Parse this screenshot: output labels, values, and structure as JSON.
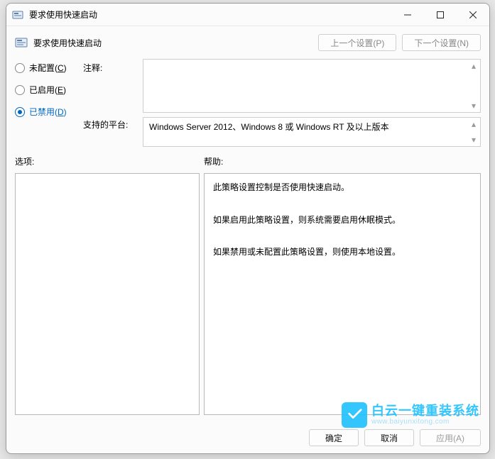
{
  "window": {
    "title": "要求使用快速启动"
  },
  "header": {
    "title": "要求使用快速启动",
    "prev_btn": "上一个设置(P)",
    "next_btn": "下一个设置(N)"
  },
  "radios": {
    "not_configured": {
      "label_pre": "未配置(",
      "accel": "C",
      "label_post": ")"
    },
    "enabled": {
      "label_pre": "已启用(",
      "accel": "E",
      "label_post": ")"
    },
    "disabled": {
      "label_pre": "已禁用(",
      "accel": "D",
      "label_post": ")"
    },
    "selected": "disabled"
  },
  "labels": {
    "comment": "注释:",
    "platform": "支持的平台:",
    "options": "选项:",
    "help": "帮助:"
  },
  "platform_text": "Windows Server 2012、Windows 8 或 Windows RT 及以上版本",
  "help_lines": [
    "此策略设置控制是否使用快速启动。",
    "如果启用此策略设置，则系统需要启用休眠模式。",
    "如果禁用或未配置此策略设置，则使用本地设置。"
  ],
  "footer": {
    "ok": "确定",
    "cancel": "取消",
    "apply": "应用(A)"
  },
  "watermark": {
    "line1": "白云一键重装系统",
    "line2": "www.baiyunxitong.com"
  }
}
